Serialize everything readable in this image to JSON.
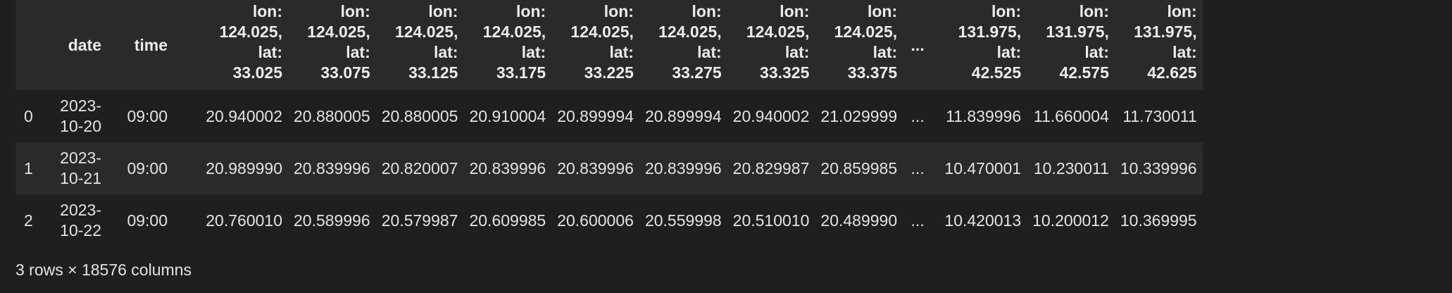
{
  "table": {
    "columns": [
      {
        "key": "date",
        "lines": [
          "date"
        ]
      },
      {
        "key": "time",
        "lines": [
          "time"
        ]
      },
      {
        "key": "c1",
        "lines": [
          "lon:",
          "124.025,",
          "lat:",
          "33.025"
        ]
      },
      {
        "key": "c2",
        "lines": [
          "lon:",
          "124.025,",
          "lat:",
          "33.075"
        ]
      },
      {
        "key": "c3",
        "lines": [
          "lon:",
          "124.025,",
          "lat:",
          "33.125"
        ]
      },
      {
        "key": "c4",
        "lines": [
          "lon:",
          "124.025,",
          "lat:",
          "33.175"
        ]
      },
      {
        "key": "c5",
        "lines": [
          "lon:",
          "124.025,",
          "lat:",
          "33.225"
        ]
      },
      {
        "key": "c6",
        "lines": [
          "lon:",
          "124.025,",
          "lat:",
          "33.275"
        ]
      },
      {
        "key": "c7",
        "lines": [
          "lon:",
          "124.025,",
          "lat:",
          "33.325"
        ]
      },
      {
        "key": "c8",
        "lines": [
          "lon:",
          "124.025,",
          "lat:",
          "33.375"
        ]
      },
      {
        "key": "ellipsis",
        "lines": [
          "..."
        ]
      },
      {
        "key": "c9",
        "lines": [
          "lon:",
          "131.975,",
          "lat:",
          "42.525"
        ]
      },
      {
        "key": "c10",
        "lines": [
          "lon:",
          "131.975,",
          "lat:",
          "42.575"
        ]
      },
      {
        "key": "c11",
        "lines": [
          "lon:",
          "131.975,",
          "lat:",
          "42.625"
        ]
      }
    ],
    "rows": [
      {
        "index": "0",
        "cells": [
          [
            "2023-",
            "10-20"
          ],
          [
            "09:00"
          ],
          [
            "20.940002"
          ],
          [
            "20.880005"
          ],
          [
            "20.880005"
          ],
          [
            "20.910004"
          ],
          [
            "20.899994"
          ],
          [
            "20.899994"
          ],
          [
            "20.940002"
          ],
          [
            "21.029999"
          ],
          [
            "..."
          ],
          [
            "11.839996"
          ],
          [
            "11.660004"
          ],
          [
            "11.730011"
          ]
        ]
      },
      {
        "index": "1",
        "cells": [
          [
            "2023-",
            "10-21"
          ],
          [
            "09:00"
          ],
          [
            "20.989990"
          ],
          [
            "20.839996"
          ],
          [
            "20.820007"
          ],
          [
            "20.839996"
          ],
          [
            "20.839996"
          ],
          [
            "20.839996"
          ],
          [
            "20.829987"
          ],
          [
            "20.859985"
          ],
          [
            "..."
          ],
          [
            "10.470001"
          ],
          [
            "10.230011"
          ],
          [
            "10.339996"
          ]
        ]
      },
      {
        "index": "2",
        "cells": [
          [
            "2023-",
            "10-22"
          ],
          [
            "09:00"
          ],
          [
            "20.760010"
          ],
          [
            "20.589996"
          ],
          [
            "20.579987"
          ],
          [
            "20.609985"
          ],
          [
            "20.600006"
          ],
          [
            "20.559998"
          ],
          [
            "20.510010"
          ],
          [
            "20.489990"
          ],
          [
            "..."
          ],
          [
            "10.420013"
          ],
          [
            "10.200012"
          ],
          [
            "10.369995"
          ]
        ]
      }
    ]
  },
  "summary": "3 rows × 18576 columns"
}
